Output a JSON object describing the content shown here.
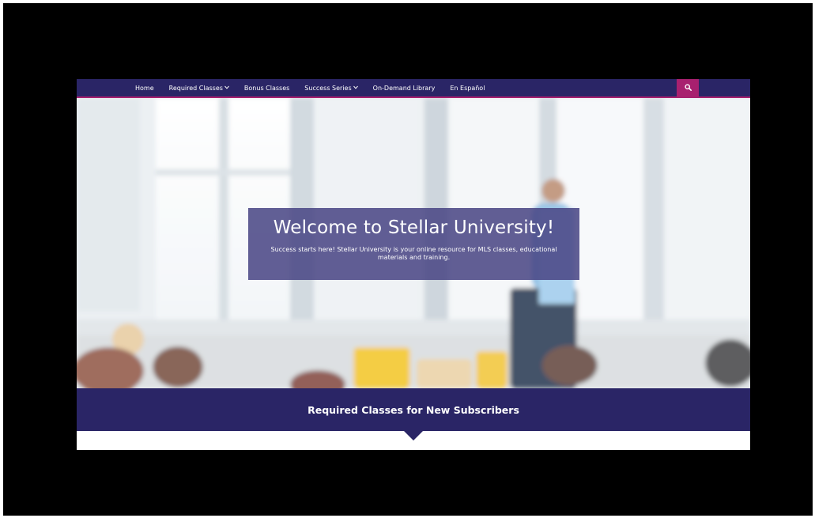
{
  "navbar": {
    "items": [
      {
        "label": "Home",
        "has_dropdown": false
      },
      {
        "label": "Required Classes",
        "has_dropdown": true
      },
      {
        "label": "Bonus Classes",
        "has_dropdown": false
      },
      {
        "label": "Success Series",
        "has_dropdown": true
      },
      {
        "label": "On-Demand Library",
        "has_dropdown": false
      },
      {
        "label": "En Español",
        "has_dropdown": false
      }
    ],
    "search_icon": "search-icon"
  },
  "hero": {
    "title": "Welcome to Stellar University!",
    "subtitle": "Success starts here! Stellar University is your online resource for MLS classes, educational materials and training."
  },
  "band": {
    "title": "Required Classes for New Subscribers"
  },
  "colors": {
    "nav_background": "#2a2566",
    "accent": "#a8206f",
    "overlay_box": "#474382"
  }
}
